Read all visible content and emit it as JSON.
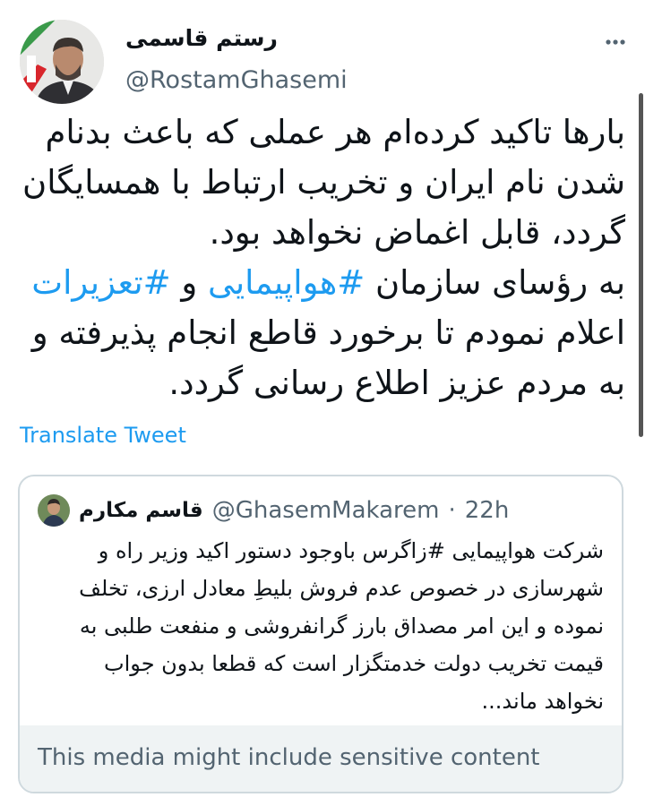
{
  "author": {
    "display_name": "رستم قاسمی",
    "handle": "@RostamGhasemi"
  },
  "tweet": {
    "part1": "بارها تاکید کرده‌ام هر عملی که باعث بدنام شدن نام ایران و تخریب ارتباط با همسایگان گردد، قابل اغماض نخواهد بود.",
    "part2_prefix": "به رؤسای سازمان ",
    "hashtag1": "#هواپیمایی",
    "part2_middle": " و ",
    "hashtag2": "#تعزیرات",
    "part2_suffix": " اعلام نمودم تا برخورد قاطع انجام پذیرفته و به مردم عزیز اطلاع رسانی گردد."
  },
  "translate_label": "Translate Tweet",
  "quoted_tweet": {
    "display_name": "قاسم مکارم",
    "handle": "@GhasemMakarem",
    "separator": "·",
    "time": "22h",
    "text_prefix": "شرکت هواپیمایی ",
    "hashtag": "#زاگرس",
    "text_suffix": " باوجود دستور اکید وزیر راه و شهرسازی در خصوص عدم فروش بلیطِ معادل ارزی، تخلف نموده و این امر مصداق بارز گرانفروشی و منفعت طلبی به قیمت تخریب دولت خدمتگزار است که قطعا بدون جواب نخواهد ماند...",
    "sensitive_notice": "This media might include sensitive content"
  },
  "icons": {
    "more": "more-horizontal-icon"
  },
  "colors": {
    "link": "#1d9bf0",
    "text": "#0f1419",
    "muted": "#536471",
    "border": "#cfd9de",
    "notice_bg": "#eff3f4"
  }
}
